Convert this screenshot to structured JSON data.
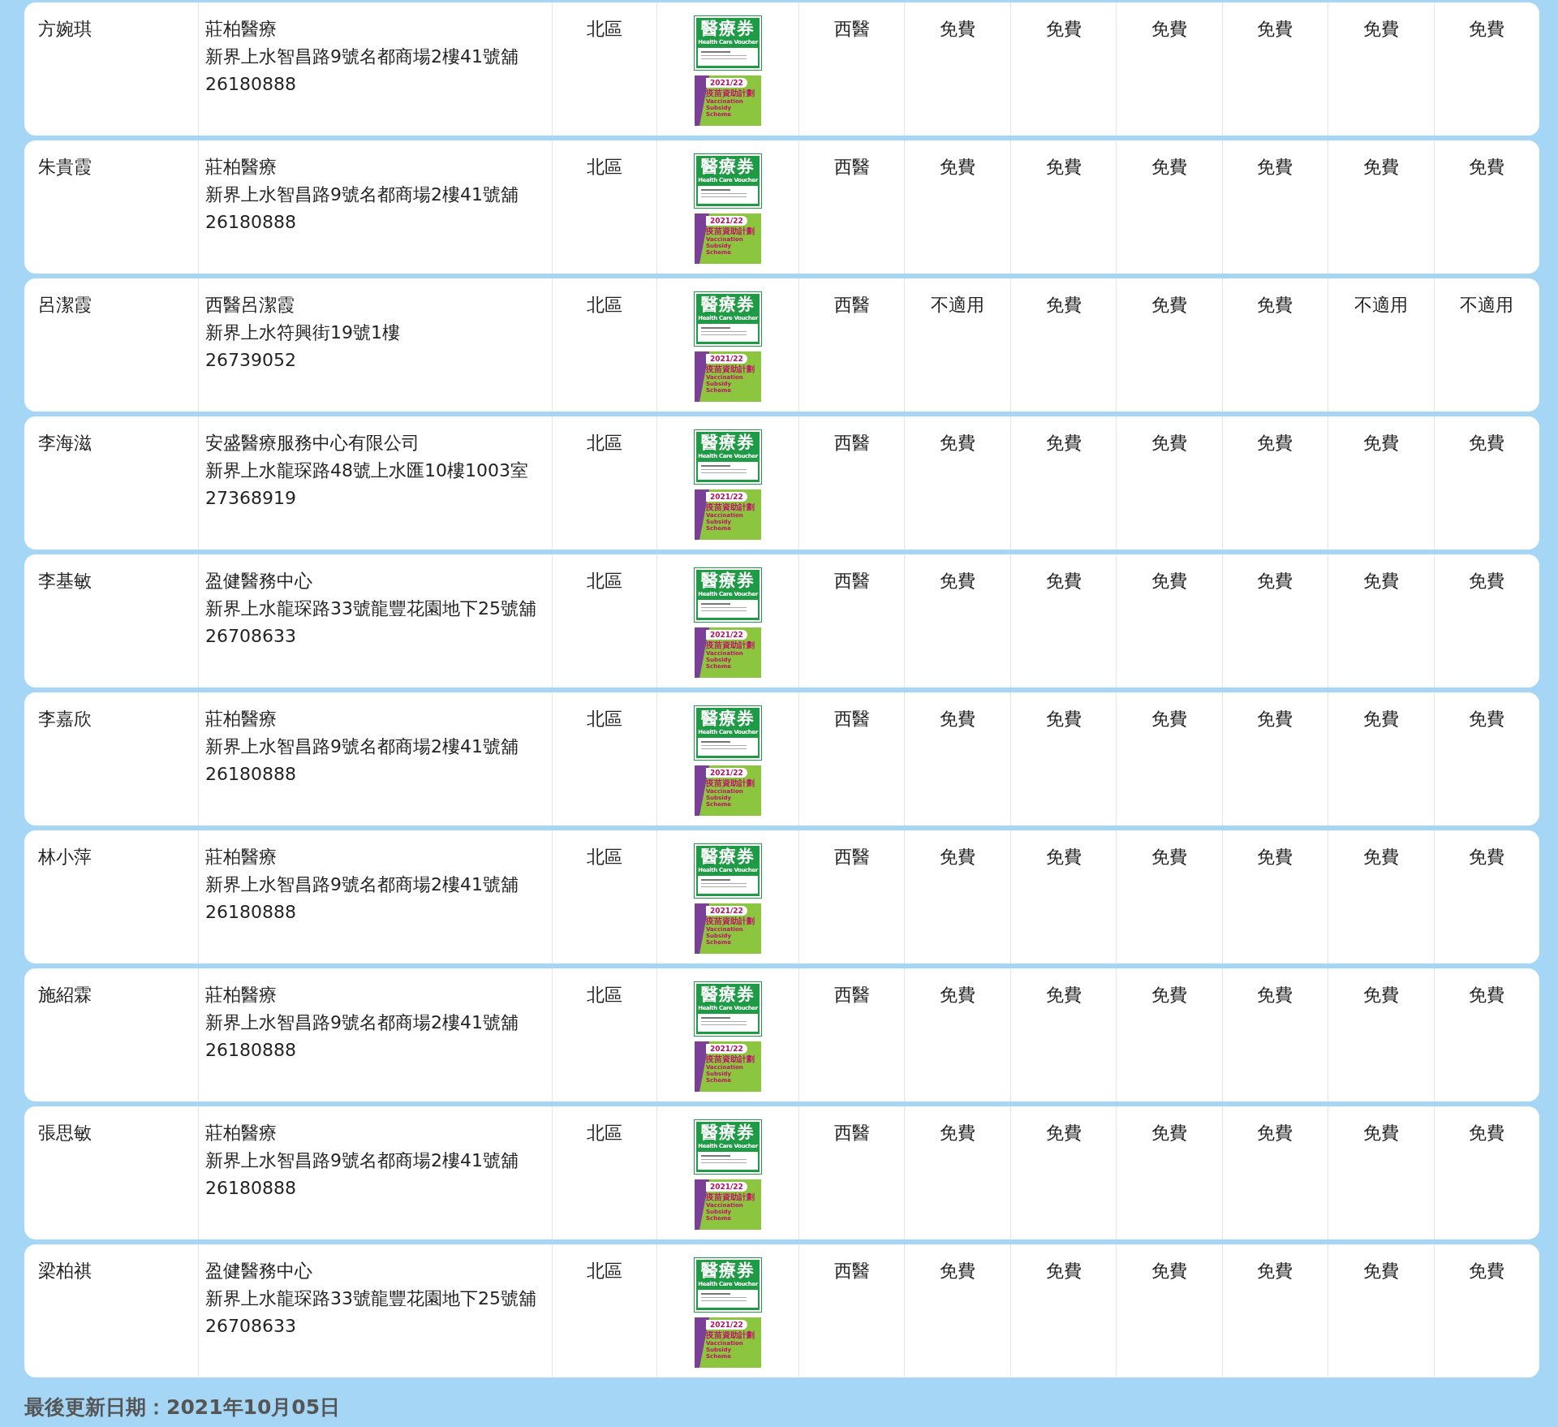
{
  "rows": [
    {
      "doctor": "方婉琪",
      "clinic": "莊柏醫療",
      "address": "新界上水智昌路9號名都商場2樓41號舖",
      "phone": "26180888",
      "district": "北區",
      "specialty": "西醫",
      "fees": [
        "免費",
        "免費",
        "免費",
        "免費",
        "免費",
        "免費"
      ],
      "badges": [
        {
          "kind": "voucher",
          "title": "醫療券",
          "subtitle": "Health Care Voucher"
        },
        {
          "kind": "vaccine",
          "year": "2021/22",
          "title": "疫苗資助計劃",
          "subtitle": "Vaccination Subsidy Scheme"
        }
      ]
    },
    {
      "doctor": "朱貴霞",
      "clinic": "莊柏醫療",
      "address": "新界上水智昌路9號名都商場2樓41號舖",
      "phone": "26180888",
      "district": "北區",
      "specialty": "西醫",
      "fees": [
        "免費",
        "免費",
        "免費",
        "免費",
        "免費",
        "免費"
      ],
      "badges": [
        {
          "kind": "voucher",
          "title": "醫療券",
          "subtitle": "Health Care Voucher"
        },
        {
          "kind": "vaccine",
          "year": "2021/22",
          "title": "疫苗資助計劃",
          "subtitle": "Vaccination Subsidy Scheme"
        }
      ]
    },
    {
      "doctor": "呂潔霞",
      "clinic": "西醫呂潔霞",
      "address": "新界上水符興街19號1樓",
      "phone": "26739052",
      "district": "北區",
      "specialty": "西醫",
      "fees": [
        "不適用",
        "免費",
        "免費",
        "免費",
        "不適用",
        "不適用"
      ],
      "badges": [
        {
          "kind": "voucher",
          "title": "醫療券",
          "subtitle": "Health Care Voucher"
        },
        {
          "kind": "vaccine",
          "year": "2021/22",
          "title": "疫苗資助計劃",
          "subtitle": "Vaccination Subsidy Scheme"
        }
      ]
    },
    {
      "doctor": "李海滋",
      "clinic": "安盛醫療服務中心有限公司",
      "address": "新界上水龍琛路48號上水匯10樓1003室",
      "phone": "27368919",
      "district": "北區",
      "specialty": "西醫",
      "fees": [
        "免費",
        "免費",
        "免費",
        "免費",
        "免費",
        "免費"
      ],
      "badges": [
        {
          "kind": "voucher",
          "title": "醫療券",
          "subtitle": "Health Care Voucher"
        },
        {
          "kind": "vaccine",
          "year": "2021/22",
          "title": "疫苗資助計劃",
          "subtitle": "Vaccination Subsidy Scheme"
        }
      ]
    },
    {
      "doctor": "李基敏",
      "clinic": "盈健醫務中心",
      "address": "新界上水龍琛路33號龍豐花園地下25號舖",
      "phone": "26708633",
      "district": "北區",
      "specialty": "西醫",
      "fees": [
        "免費",
        "免費",
        "免費",
        "免費",
        "免費",
        "免費"
      ],
      "badges": [
        {
          "kind": "voucher",
          "title": "醫療券",
          "subtitle": "Health Care Voucher"
        },
        {
          "kind": "vaccine",
          "year": "2021/22",
          "title": "疫苗資助計劃",
          "subtitle": "Vaccination Subsidy Scheme"
        }
      ]
    },
    {
      "doctor": "李嘉欣",
      "clinic": "莊柏醫療",
      "address": "新界上水智昌路9號名都商場2樓41號舖",
      "phone": "26180888",
      "district": "北區",
      "specialty": "西醫",
      "fees": [
        "免費",
        "免費",
        "免費",
        "免費",
        "免費",
        "免費"
      ],
      "badges": [
        {
          "kind": "voucher",
          "title": "醫療券",
          "subtitle": "Health Care Voucher"
        },
        {
          "kind": "vaccine",
          "year": "2021/22",
          "title": "疫苗資助計劃",
          "subtitle": "Vaccination Subsidy Scheme"
        }
      ]
    },
    {
      "doctor": "林小萍",
      "clinic": "莊柏醫療",
      "address": "新界上水智昌路9號名都商場2樓41號舖",
      "phone": "26180888",
      "district": "北區",
      "specialty": "西醫",
      "fees": [
        "免費",
        "免費",
        "免費",
        "免費",
        "免費",
        "免費"
      ],
      "badges": [
        {
          "kind": "voucher",
          "title": "醫療券",
          "subtitle": "Health Care Voucher"
        },
        {
          "kind": "vaccine",
          "year": "2021/22",
          "title": "疫苗資助計劃",
          "subtitle": "Vaccination Subsidy Scheme"
        }
      ]
    },
    {
      "doctor": "施紹霖",
      "clinic": "莊柏醫療",
      "address": "新界上水智昌路9號名都商場2樓41號舖",
      "phone": "26180888",
      "district": "北區",
      "specialty": "西醫",
      "fees": [
        "免費",
        "免費",
        "免費",
        "免費",
        "免費",
        "免費"
      ],
      "badges": [
        {
          "kind": "voucher",
          "title": "醫療券",
          "subtitle": "Health Care Voucher"
        },
        {
          "kind": "vaccine",
          "year": "2021/22",
          "title": "疫苗資助計劃",
          "subtitle": "Vaccination Subsidy Scheme"
        }
      ]
    },
    {
      "doctor": "張思敏",
      "clinic": "莊柏醫療",
      "address": "新界上水智昌路9號名都商場2樓41號舖",
      "phone": "26180888",
      "district": "北區",
      "specialty": "西醫",
      "fees": [
        "免費",
        "免費",
        "免費",
        "免費",
        "免費",
        "免費"
      ],
      "badges": [
        {
          "kind": "voucher",
          "title": "醫療券",
          "subtitle": "Health Care Voucher"
        },
        {
          "kind": "vaccine",
          "year": "2021/22",
          "title": "疫苗資助計劃",
          "subtitle": "Vaccination Subsidy Scheme"
        }
      ]
    },
    {
      "doctor": "梁柏祺",
      "clinic": "盈健醫務中心",
      "address": "新界上水龍琛路33號龍豐花園地下25號舖",
      "phone": "26708633",
      "district": "北區",
      "specialty": "西醫",
      "fees": [
        "免費",
        "免費",
        "免費",
        "免費",
        "免費",
        "免費"
      ],
      "badges": [
        {
          "kind": "voucher",
          "title": "醫療券",
          "subtitle": "Health Care Voucher"
        },
        {
          "kind": "vaccine",
          "year": "2021/22",
          "title": "疫苗資助計劃",
          "subtitle": "Vaccination Subsidy Scheme"
        }
      ]
    }
  ],
  "footer": "最後更新日期：2021年10月05日"
}
